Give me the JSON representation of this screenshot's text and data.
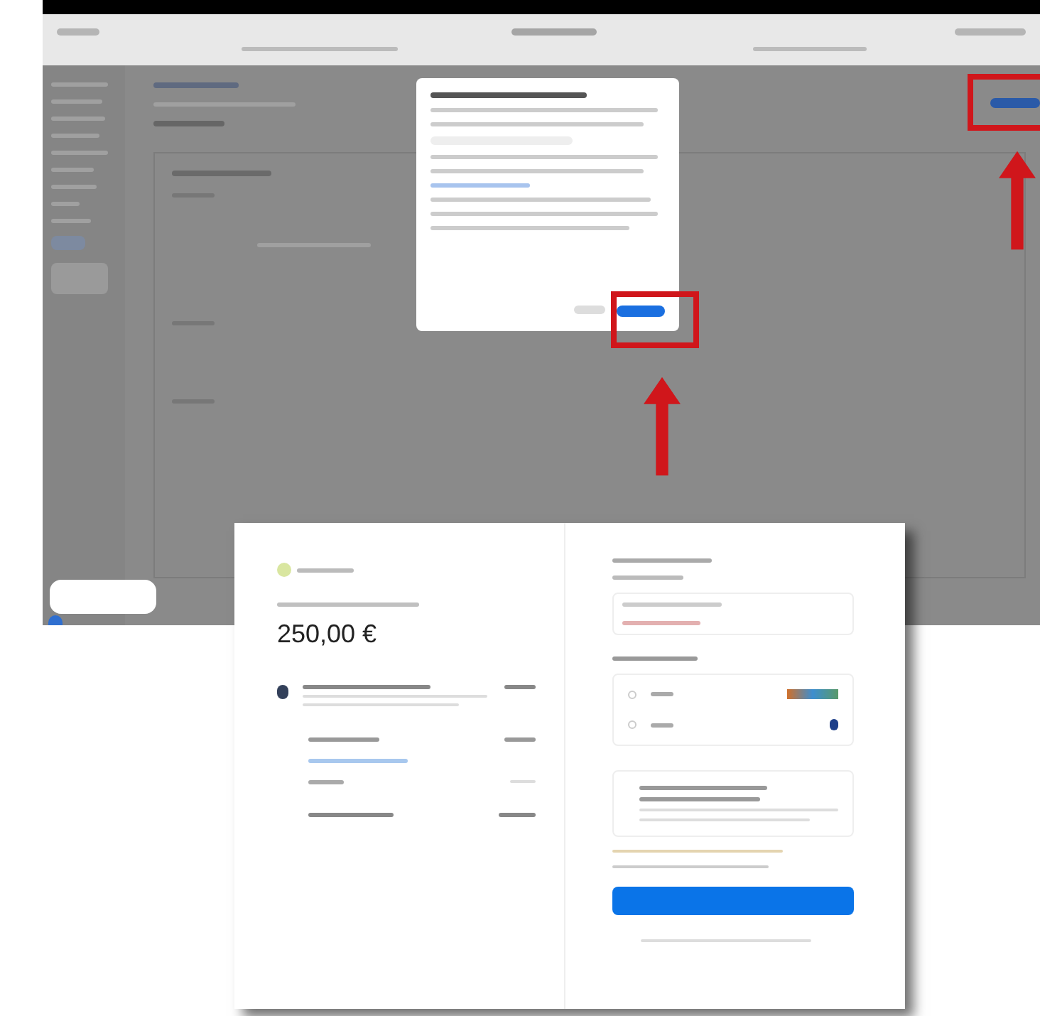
{
  "checkout": {
    "amount": "250,00 €",
    "payment_methods": [
      {
        "selected": false
      },
      {
        "selected": false
      }
    ]
  }
}
